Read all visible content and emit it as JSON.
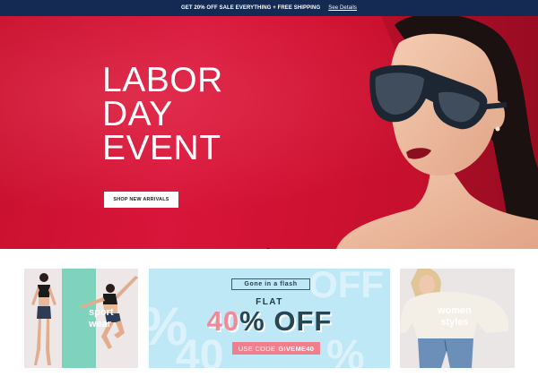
{
  "promo_bar": {
    "message": "GET 20% OFF SALE EVERYTHING + FREE SHIPPING",
    "link": "See Details"
  },
  "hero": {
    "title_lines": [
      "LABOR",
      "DAY",
      "EVENT"
    ],
    "cta": "SHOP NEW ARRIVALS",
    "slide_count": 3,
    "active_slide": 2,
    "colors": {
      "background": "#c8102e",
      "text": "#ffffff"
    }
  },
  "tiles": {
    "sport": {
      "label_line1": "sport",
      "label_line2": "wear"
    },
    "sale": {
      "kicker": "Gone in a flash",
      "flat": "FLAT",
      "pct": "40",
      "off": "% OFF",
      "code_prefix": "USE CODE",
      "code": "GIVEME40",
      "bg_text": "OFF"
    },
    "women": {
      "label_line1": "women",
      "label_line2": "styles"
    }
  },
  "colors": {
    "topbar": "#142a52",
    "sale_bg": "#bfe8f6",
    "sale_pink": "#f08a98",
    "mint": "#7fd3bd"
  }
}
